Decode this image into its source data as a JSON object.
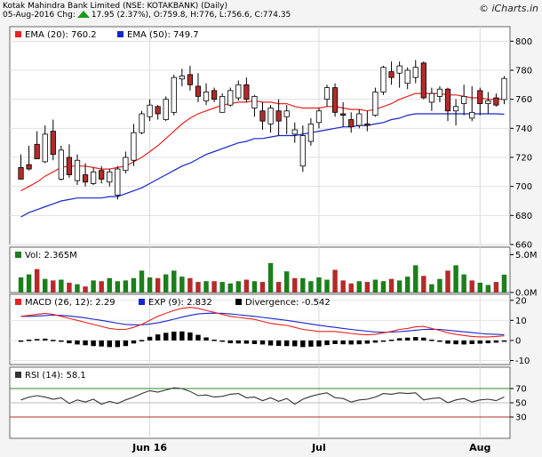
{
  "header": {
    "title": "Kotak Mahindra Bank Limited (NSE: KOTAKBANK) (Daily)",
    "quote_date": "05-Aug-2016 Chg:",
    "quote_values": "17.95 (2.37%), O:759.8, H:776, L:756.6, C:774.35",
    "brand": "© iCharts.in"
  },
  "colors": {
    "up": "#ffffff",
    "down": "#b52a2a",
    "ema20": "#e8221f",
    "ema50": "#1726c9",
    "vol_up": "#1b7f1b",
    "vol_down": "#b52a2a",
    "vol_neutral": "#9a9a9a",
    "macd": "#e8221f",
    "exp": "#1726c9",
    "divergence": "#000000",
    "rsi": "#333333",
    "rsi_band": "#2b8a2b"
  },
  "chart_data": [
    {
      "type": "candlestick",
      "legend": [
        {
          "label": "EMA (20): 760.2",
          "color": "#e8221f"
        },
        {
          "label": "EMA (50): 749.7",
          "color": "#1726c9"
        }
      ],
      "ylim": [
        660,
        810
      ],
      "yticks": [
        660,
        680,
        700,
        720,
        740,
        760,
        780,
        800
      ],
      "x_labels": [
        {
          "label": "Jun 16",
          "index": 16
        },
        {
          "label": "Jul",
          "index": 37
        },
        {
          "label": "Aug",
          "index": 57
        }
      ],
      "candles": [
        [
          713,
          722,
          708,
          705
        ],
        [
          715,
          728,
          711,
          712
        ],
        [
          729,
          738,
          719,
          719
        ],
        [
          717,
          742,
          716,
          736
        ],
        [
          738,
          746,
          718,
          722
        ],
        [
          705,
          728,
          704,
          725
        ],
        [
          720,
          729,
          706,
          708
        ],
        [
          704,
          722,
          701,
          718
        ],
        [
          708,
          716,
          700,
          703
        ],
        [
          702,
          713,
          701,
          710
        ],
        [
          711,
          714,
          702,
          705
        ],
        [
          703,
          712,
          700,
          710
        ],
        [
          694,
          714,
          691,
          712
        ],
        [
          711,
          724,
          709,
          720
        ],
        [
          718,
          743,
          714,
          737
        ],
        [
          737,
          752,
          736,
          750
        ],
        [
          748,
          760,
          745,
          756
        ],
        [
          755,
          756,
          746,
          750
        ],
        [
          746,
          762,
          745,
          760
        ],
        [
          751,
          777,
          749,
          775
        ],
        [
          774,
          781,
          769,
          776
        ],
        [
          777,
          783,
          766,
          770
        ],
        [
          769,
          778,
          758,
          762
        ],
        [
          759,
          771,
          756,
          765
        ],
        [
          766,
          768,
          758,
          760
        ],
        [
          751,
          764,
          751,
          762
        ],
        [
          756,
          768,
          755,
          766
        ],
        [
          761,
          773,
          759,
          770
        ],
        [
          770,
          775,
          758,
          760
        ],
        [
          754,
          763,
          748,
          762
        ],
        [
          752,
          758,
          739,
          745
        ],
        [
          743,
          756,
          737,
          754
        ],
        [
          752,
          760,
          735,
          745
        ],
        [
          748,
          756,
          736,
          752
        ],
        [
          736,
          744,
          730,
          739
        ],
        [
          714,
          742,
          710,
          735
        ],
        [
          731,
          747,
          728,
          743
        ],
        [
          744,
          754,
          740,
          752
        ],
        [
          760,
          770,
          755,
          768
        ],
        [
          768,
          771,
          748,
          751
        ],
        [
          750,
          758,
          741,
          749
        ],
        [
          746,
          751,
          737,
          741
        ],
        [
          742,
          753,
          740,
          750
        ],
        [
          743,
          752,
          738,
          742
        ],
        [
          749,
          768,
          748,
          765
        ],
        [
          765,
          783,
          763,
          782
        ],
        [
          779,
          786,
          770,
          775
        ],
        [
          778,
          786,
          768,
          783
        ],
        [
          771,
          782,
          767,
          780
        ],
        [
          775,
          787,
          771,
          782
        ],
        [
          785,
          786,
          760,
          761
        ],
        [
          758,
          768,
          752,
          764
        ],
        [
          762,
          769,
          758,
          767
        ],
        [
          767,
          768,
          745,
          752
        ],
        [
          752,
          760,
          742,
          755
        ],
        [
          757,
          770,
          749,
          762
        ],
        [
          747,
          769,
          745,
          751
        ],
        [
          766,
          768,
          749,
          757
        ],
        [
          757,
          765,
          750,
          759
        ],
        [
          761,
          764,
          755,
          756
        ],
        [
          759.8,
          776,
          756.6,
          774.35
        ]
      ],
      "ema20": [
        697,
        700,
        703,
        707,
        710,
        713,
        714,
        714,
        714,
        713,
        712,
        712,
        713,
        714,
        717,
        720,
        724,
        728,
        733,
        738,
        743,
        747,
        750,
        752,
        754,
        756,
        757,
        758,
        758,
        759,
        758,
        758,
        757,
        757,
        755,
        754,
        754,
        754,
        755,
        755,
        754,
        753,
        753,
        752,
        753,
        755,
        757,
        760,
        762,
        764,
        764,
        764,
        764,
        763,
        763,
        762,
        761,
        761,
        760,
        760,
        760.2
      ],
      "ema50": [
        679,
        682,
        684,
        686,
        688,
        690,
        691,
        692,
        692,
        692,
        692,
        693,
        693,
        695,
        697,
        699,
        702,
        705,
        708,
        711,
        714,
        716,
        719,
        722,
        724,
        726,
        728,
        730,
        731,
        733,
        733,
        734,
        735,
        735,
        735,
        736,
        737,
        738,
        739,
        740,
        741,
        741,
        742,
        742,
        743,
        744,
        746,
        747,
        749,
        750,
        750,
        750,
        750,
        750,
        750,
        750,
        750,
        750,
        750,
        750,
        749.7
      ]
    },
    {
      "type": "bar",
      "legend": [
        {
          "label": "Vol: 2.365M",
          "color": "#1b7f1b"
        }
      ],
      "ylim": [
        0,
        6
      ],
      "yticks": [
        {
          "v": 5,
          "label": "5.0M"
        },
        {
          "v": 0,
          "label": "0.0M"
        }
      ],
      "values": [
        2.0,
        2.4,
        3.1,
        1.8,
        1.6,
        1.7,
        1.3,
        1.1,
        0.8,
        1.6,
        1.5,
        1.9,
        1.5,
        1.6,
        1.9,
        2.9,
        2.0,
        1.9,
        2.4,
        2.9,
        2.1,
        1.9,
        1.4,
        1.5,
        1.5,
        1.4,
        1.2,
        1.5,
        1.7,
        1.5,
        1.4,
        3.9,
        1.4,
        2.8,
        1.9,
        1.9,
        1.5,
        2.0,
        1.7,
        3.0,
        1.6,
        1.2,
        1.5,
        1.4,
        1.7,
        1.5,
        1.8,
        1.6,
        2.1,
        3.6,
        2.2,
        1.1,
        1.8,
        2.9,
        3.6,
        2.4,
        1.6,
        1.3,
        1.0,
        1.4,
        2.365
      ],
      "directions": [
        1,
        1,
        -1,
        1,
        -1,
        1,
        -1,
        1,
        -1,
        1,
        -1,
        1,
        1,
        1,
        1,
        1,
        1,
        -1,
        1,
        1,
        1,
        -1,
        -1,
        1,
        -1,
        1,
        1,
        1,
        -1,
        1,
        -1,
        1,
        -1,
        1,
        -1,
        1,
        1,
        1,
        1,
        -1,
        -1,
        -1,
        1,
        -1,
        1,
        1,
        -1,
        1,
        1,
        1,
        -1,
        1,
        1,
        -1,
        1,
        1,
        -1,
        1,
        1,
        -1,
        1
      ]
    },
    {
      "type": "line",
      "legend": [
        {
          "label": "MACD (26, 12): 2.29",
          "color": "#e8221f"
        },
        {
          "label": "EXP (9): 2.832",
          "color": "#1726c9"
        },
        {
          "label": "Divergence: -0.542",
          "color": "#000000"
        }
      ],
      "ylim": [
        -12,
        23
      ],
      "yticks": [
        -10,
        0,
        10,
        20
      ],
      "macd": [
        12,
        12.5,
        13,
        13.5,
        13,
        12,
        11,
        10,
        9,
        8,
        7,
        6,
        5.5,
        5.5,
        6.5,
        8,
        10,
        12,
        13.5,
        15,
        16,
        16.5,
        16,
        15,
        14,
        13,
        12,
        11.5,
        11,
        10.5,
        9.5,
        8.5,
        8,
        7.5,
        6.5,
        5.5,
        5,
        4.5,
        4.5,
        4.5,
        4,
        3.5,
        3,
        2.8,
        3,
        3.8,
        4.5,
        5.5,
        6,
        6.8,
        7,
        6,
        5,
        3.8,
        3,
        2.5,
        2,
        1.8,
        1.8,
        2,
        2.29
      ],
      "exp": [
        12,
        12,
        12.2,
        12.4,
        12.6,
        12.5,
        12.2,
        11.8,
        11.2,
        10.6,
        10,
        9.3,
        8.6,
        8,
        7.8,
        7.8,
        8.2,
        8.8,
        9.6,
        10.6,
        11.6,
        12.5,
        13.2,
        13.5,
        13.6,
        13.5,
        13.2,
        12.8,
        12.4,
        12,
        11.5,
        11,
        10.5,
        10,
        9.4,
        8.8,
        8.2,
        7.6,
        7,
        6.5,
        6,
        5.5,
        5,
        4.6,
        4.2,
        4.1,
        4.2,
        4.4,
        4.7,
        5.1,
        5.5,
        5.6,
        5.5,
        5.1,
        4.7,
        4.3,
        3.9,
        3.5,
        3.2,
        3,
        2.832
      ],
      "divergence": [
        0,
        0.4,
        0.7,
        0.9,
        0.3,
        -0.6,
        -1.4,
        -2,
        -2.4,
        -2.8,
        -3,
        -3.3,
        -3.3,
        -2.8,
        -1.5,
        0.2,
        1.8,
        3,
        3.8,
        4.4,
        4.5,
        4,
        2.8,
        1.5,
        0.4,
        -0.6,
        -1.4,
        -1.5,
        -1.6,
        -1.8,
        -2,
        -2.5,
        -2.7,
        -2.8,
        -2.9,
        -3.3,
        -3.1,
        -3,
        -2.3,
        -1.8,
        -1.9,
        -2,
        -1.9,
        -1.6,
        -1.1,
        -0.3,
        0.4,
        1.1,
        1.4,
        1.7,
        1.4,
        0.4,
        -0.7,
        -1.6,
        -1.9,
        -2,
        -1.8,
        -1.6,
        -1.4,
        -1.1,
        -0.542
      ]
    },
    {
      "type": "line",
      "legend": [
        {
          "label": "RSI (14): 58.1",
          "color": "#333333"
        }
      ],
      "ylim": [
        0,
        100
      ],
      "yticks": [
        30,
        50,
        70
      ],
      "bands": [
        30,
        50,
        70
      ],
      "values": [
        54,
        58,
        60,
        58,
        55,
        57,
        49,
        54,
        51,
        55,
        48,
        52,
        49,
        54,
        58,
        63,
        67,
        65,
        68,
        71,
        70,
        66,
        60,
        61,
        58,
        59,
        62,
        63,
        57,
        58,
        53,
        57,
        52,
        56,
        48,
        55,
        59,
        62,
        64,
        57,
        56,
        51,
        54,
        55,
        58,
        63,
        62,
        64,
        63,
        64,
        54,
        56,
        57,
        50,
        54,
        56,
        51,
        54,
        55,
        53,
        58.1
      ]
    }
  ]
}
